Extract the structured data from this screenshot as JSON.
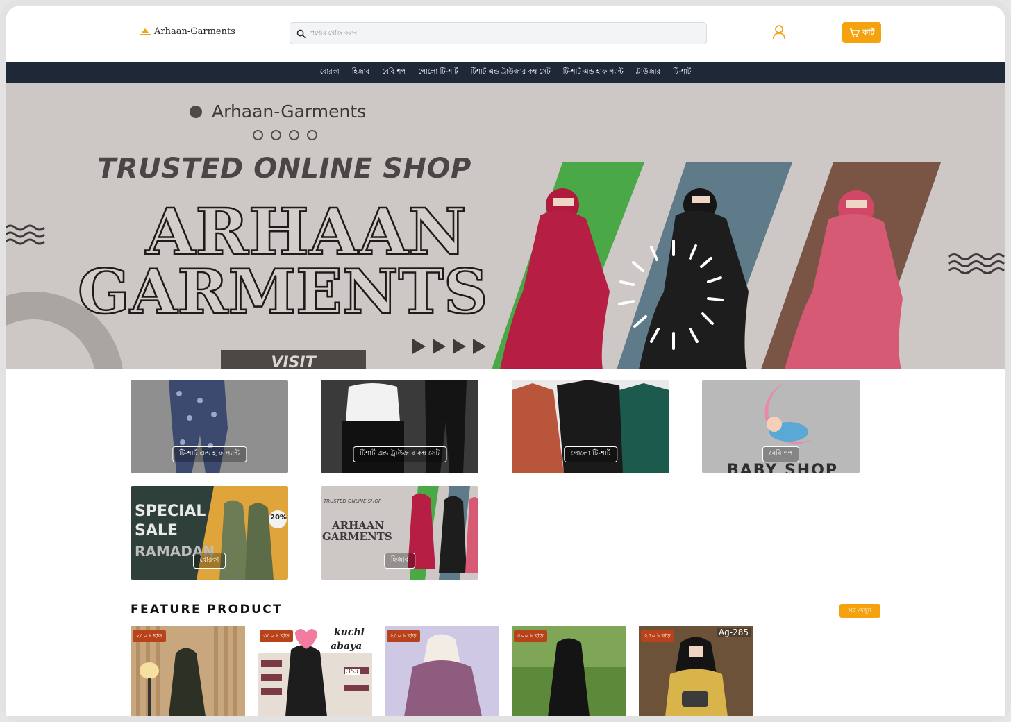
{
  "header": {
    "logo_text": "Arhaan-Garments",
    "search_placeholder": "পণ্যের খোঁজ করুন",
    "cart_label": "কার্ট"
  },
  "nav": {
    "items": [
      "বোরকা",
      "হিজাব",
      "বেবি শপ",
      "পোলো টি-শার্ট",
      "টিশার্ট এন্ড ট্রাউজার কম্ব সেট",
      "টি-শার্ট এন্ড হাফ প্যান্ট",
      "ট্রাউজার",
      "টি-শার্ট"
    ]
  },
  "banner": {
    "brand": "Arhaan-Garments",
    "tagline": "TRUSTED ONLINE SHOP",
    "title_line1": "ARHAAN",
    "title_line2": "GARMENTS",
    "visit": "VISIT"
  },
  "categories": [
    {
      "label": "টি-শার্ট এন্ড হাফ প্যান্ট"
    },
    {
      "label": "টিশার্ট এন্ড ট্রাউজার কম্ব সেট"
    },
    {
      "label": "পোলো টি-শার্ট"
    },
    {
      "label": "বেবি শপ",
      "image_text": "BABY SHOP"
    },
    {
      "label": "বোরকা",
      "image_text_1": "SPECIAL",
      "image_text_2": "SALE",
      "image_text_3": "RAMADAN",
      "badge": "20%"
    },
    {
      "label": "হিজাব",
      "image_text_1": "TRUSTED ONLINE SHOP",
      "image_text_2": "ARHAAN",
      "image_text_3": "GARMENTS"
    }
  ],
  "feature": {
    "title": "FEATURE PRODUCT",
    "see_all": "সব দেখুন",
    "products": [
      {
        "discount": "২৫০ ৳ ছাড়"
      },
      {
        "discount": "৩৫০ ৳ ছাড়",
        "caption_1": "kuchi",
        "caption_2": "abaya",
        "code": "353"
      },
      {
        "discount": "২৫০ ৳ ছাড়"
      },
      {
        "discount": "৫০০ ৳ ছাড়"
      },
      {
        "discount": "২৫০ ৳ ছাড়",
        "code": "Ag-285"
      }
    ]
  },
  "colors": {
    "accent": "#f5a20f",
    "nav_bg": "#1e2837",
    "banner_bg": "#cdc8c5",
    "discount_badge": "#b8431b"
  }
}
